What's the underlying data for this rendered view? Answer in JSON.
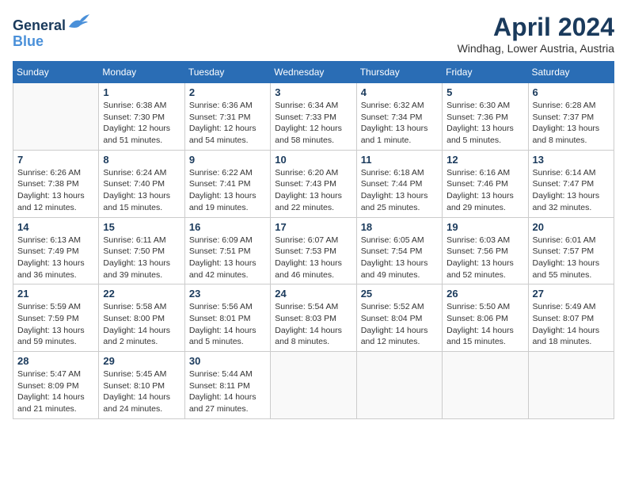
{
  "header": {
    "logo_line1": "General",
    "logo_line2": "Blue",
    "month": "April 2024",
    "location": "Windhag, Lower Austria, Austria"
  },
  "weekdays": [
    "Sunday",
    "Monday",
    "Tuesday",
    "Wednesday",
    "Thursday",
    "Friday",
    "Saturday"
  ],
  "weeks": [
    [
      {
        "day": "",
        "info": ""
      },
      {
        "day": "1",
        "info": "Sunrise: 6:38 AM\nSunset: 7:30 PM\nDaylight: 12 hours\nand 51 minutes."
      },
      {
        "day": "2",
        "info": "Sunrise: 6:36 AM\nSunset: 7:31 PM\nDaylight: 12 hours\nand 54 minutes."
      },
      {
        "day": "3",
        "info": "Sunrise: 6:34 AM\nSunset: 7:33 PM\nDaylight: 12 hours\nand 58 minutes."
      },
      {
        "day": "4",
        "info": "Sunrise: 6:32 AM\nSunset: 7:34 PM\nDaylight: 13 hours\nand 1 minute."
      },
      {
        "day": "5",
        "info": "Sunrise: 6:30 AM\nSunset: 7:36 PM\nDaylight: 13 hours\nand 5 minutes."
      },
      {
        "day": "6",
        "info": "Sunrise: 6:28 AM\nSunset: 7:37 PM\nDaylight: 13 hours\nand 8 minutes."
      }
    ],
    [
      {
        "day": "7",
        "info": "Sunrise: 6:26 AM\nSunset: 7:38 PM\nDaylight: 13 hours\nand 12 minutes."
      },
      {
        "day": "8",
        "info": "Sunrise: 6:24 AM\nSunset: 7:40 PM\nDaylight: 13 hours\nand 15 minutes."
      },
      {
        "day": "9",
        "info": "Sunrise: 6:22 AM\nSunset: 7:41 PM\nDaylight: 13 hours\nand 19 minutes."
      },
      {
        "day": "10",
        "info": "Sunrise: 6:20 AM\nSunset: 7:43 PM\nDaylight: 13 hours\nand 22 minutes."
      },
      {
        "day": "11",
        "info": "Sunrise: 6:18 AM\nSunset: 7:44 PM\nDaylight: 13 hours\nand 25 minutes."
      },
      {
        "day": "12",
        "info": "Sunrise: 6:16 AM\nSunset: 7:46 PM\nDaylight: 13 hours\nand 29 minutes."
      },
      {
        "day": "13",
        "info": "Sunrise: 6:14 AM\nSunset: 7:47 PM\nDaylight: 13 hours\nand 32 minutes."
      }
    ],
    [
      {
        "day": "14",
        "info": "Sunrise: 6:13 AM\nSunset: 7:49 PM\nDaylight: 13 hours\nand 36 minutes."
      },
      {
        "day": "15",
        "info": "Sunrise: 6:11 AM\nSunset: 7:50 PM\nDaylight: 13 hours\nand 39 minutes."
      },
      {
        "day": "16",
        "info": "Sunrise: 6:09 AM\nSunset: 7:51 PM\nDaylight: 13 hours\nand 42 minutes."
      },
      {
        "day": "17",
        "info": "Sunrise: 6:07 AM\nSunset: 7:53 PM\nDaylight: 13 hours\nand 46 minutes."
      },
      {
        "day": "18",
        "info": "Sunrise: 6:05 AM\nSunset: 7:54 PM\nDaylight: 13 hours\nand 49 minutes."
      },
      {
        "day": "19",
        "info": "Sunrise: 6:03 AM\nSunset: 7:56 PM\nDaylight: 13 hours\nand 52 minutes."
      },
      {
        "day": "20",
        "info": "Sunrise: 6:01 AM\nSunset: 7:57 PM\nDaylight: 13 hours\nand 55 minutes."
      }
    ],
    [
      {
        "day": "21",
        "info": "Sunrise: 5:59 AM\nSunset: 7:59 PM\nDaylight: 13 hours\nand 59 minutes."
      },
      {
        "day": "22",
        "info": "Sunrise: 5:58 AM\nSunset: 8:00 PM\nDaylight: 14 hours\nand 2 minutes."
      },
      {
        "day": "23",
        "info": "Sunrise: 5:56 AM\nSunset: 8:01 PM\nDaylight: 14 hours\nand 5 minutes."
      },
      {
        "day": "24",
        "info": "Sunrise: 5:54 AM\nSunset: 8:03 PM\nDaylight: 14 hours\nand 8 minutes."
      },
      {
        "day": "25",
        "info": "Sunrise: 5:52 AM\nSunset: 8:04 PM\nDaylight: 14 hours\nand 12 minutes."
      },
      {
        "day": "26",
        "info": "Sunrise: 5:50 AM\nSunset: 8:06 PM\nDaylight: 14 hours\nand 15 minutes."
      },
      {
        "day": "27",
        "info": "Sunrise: 5:49 AM\nSunset: 8:07 PM\nDaylight: 14 hours\nand 18 minutes."
      }
    ],
    [
      {
        "day": "28",
        "info": "Sunrise: 5:47 AM\nSunset: 8:09 PM\nDaylight: 14 hours\nand 21 minutes."
      },
      {
        "day": "29",
        "info": "Sunrise: 5:45 AM\nSunset: 8:10 PM\nDaylight: 14 hours\nand 24 minutes."
      },
      {
        "day": "30",
        "info": "Sunrise: 5:44 AM\nSunset: 8:11 PM\nDaylight: 14 hours\nand 27 minutes."
      },
      {
        "day": "",
        "info": ""
      },
      {
        "day": "",
        "info": ""
      },
      {
        "day": "",
        "info": ""
      },
      {
        "day": "",
        "info": ""
      }
    ]
  ]
}
